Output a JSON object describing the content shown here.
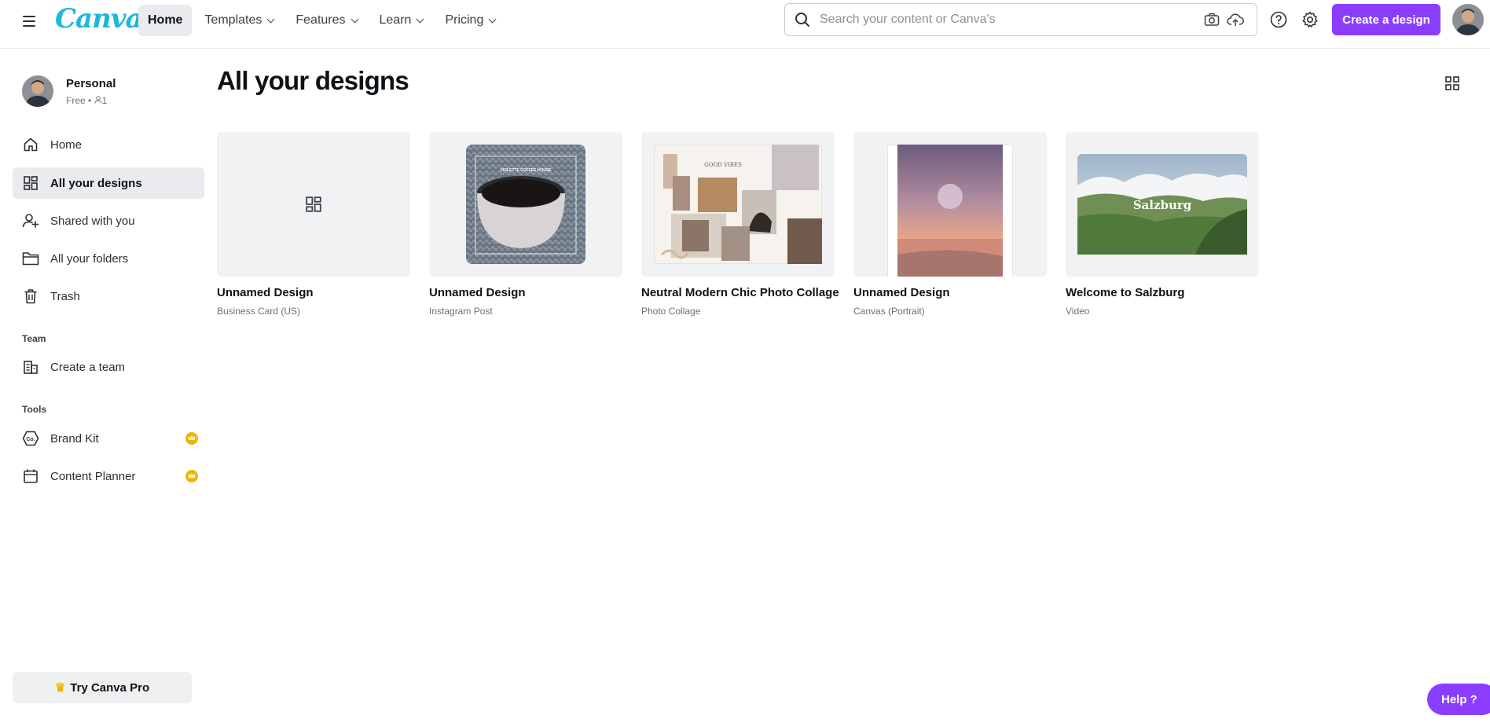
{
  "header": {
    "logo": "Canva",
    "nav": [
      {
        "label": "Home"
      },
      {
        "label": "Templates"
      },
      {
        "label": "Features"
      },
      {
        "label": "Learn"
      },
      {
        "label": "Pricing"
      }
    ],
    "search_placeholder": "Search your content or Canva's",
    "create_label": "Create a design"
  },
  "sidebar": {
    "profile_name": "Personal",
    "profile_plan": "Free",
    "profile_members": "1",
    "items": [
      {
        "label": "Home",
        "icon": "home-icon"
      },
      {
        "label": "All your designs",
        "icon": "designs-grid-icon"
      },
      {
        "label": "Shared with you",
        "icon": "shared-users-icon"
      },
      {
        "label": "All your folders",
        "icon": "folder-icon"
      },
      {
        "label": "Trash",
        "icon": "trash-icon"
      }
    ],
    "team_section": "Team",
    "team_items": [
      {
        "label": "Create a team",
        "icon": "team-building-icon"
      }
    ],
    "tools_section": "Tools",
    "tools_items": [
      {
        "label": "Brand Kit",
        "icon": "brand-kit-icon"
      },
      {
        "label": "Content Planner",
        "icon": "calendar-icon"
      }
    ],
    "try_pro_label": "Try Canva Pro"
  },
  "main": {
    "title": "All your designs",
    "designs": [
      {
        "title": "Unnamed Design",
        "type": "Business Card (US)"
      },
      {
        "title": "Unnamed Design",
        "type": "Instagram Post"
      },
      {
        "title": "Neutral Modern Chic Photo Collage",
        "type": "Photo Collage"
      },
      {
        "title": "Unnamed Design",
        "type": "Canvas (Portrait)"
      },
      {
        "title": "Welcome to Salzburg",
        "type": "Video"
      }
    ],
    "thumb_text": {
      "coffee": "VIOLETTE COFFEE HOUSE",
      "collage": "GOOD VIBES",
      "salzburg": "Salzburg"
    }
  },
  "help_label": "Help ?",
  "colors": {
    "accent": "#8b3dff",
    "logo": "#1db8d9",
    "crown": "#f5b400"
  }
}
